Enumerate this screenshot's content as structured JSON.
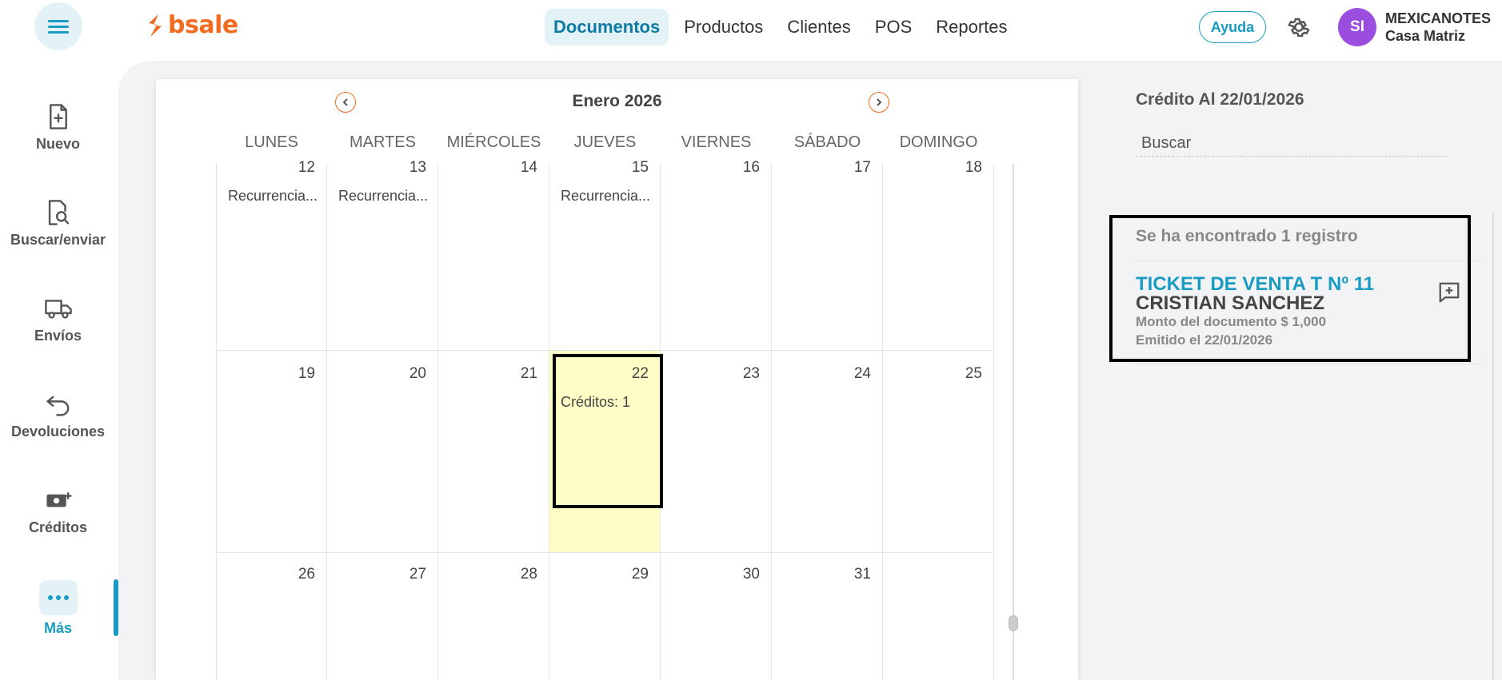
{
  "brand": {
    "logo_text": "bsale",
    "accent": "#f26b21",
    "primary": "#1a9bc4"
  },
  "header": {
    "menu_icon": "hamburger-icon",
    "nav": [
      {
        "label": "Documentos",
        "active": true
      },
      {
        "label": "Productos",
        "active": false
      },
      {
        "label": "Clientes",
        "active": false
      },
      {
        "label": "POS",
        "active": false
      },
      {
        "label": "Reportes",
        "active": false
      }
    ],
    "help_label": "Ayuda",
    "settings_icon": "gear-icon",
    "avatar_initials": "SI",
    "company_name": "MEXICANOTES",
    "branch_name": "Casa Matriz"
  },
  "sidebar": {
    "items": [
      {
        "label": "Nuevo",
        "icon": "new-document-icon"
      },
      {
        "label": "Buscar/enviar",
        "icon": "search-document-icon"
      },
      {
        "label": "Envíos",
        "icon": "truck-icon"
      },
      {
        "label": "Devoluciones",
        "icon": "return-arrow-icon"
      },
      {
        "label": "Créditos",
        "icon": "credit-money-icon"
      },
      {
        "label": "Más",
        "icon": "more-dots-icon",
        "active": true
      }
    ]
  },
  "calendar": {
    "month_label": "Enero 2026",
    "prev_icon": "chevron-left-icon",
    "next_icon": "chevron-right-icon",
    "weekdays": [
      "LUNES",
      "MARTES",
      "MIÉRCOLES",
      "JUEVES",
      "VIERNES",
      "SÁBADO",
      "DOMINGO"
    ],
    "weeks": [
      [
        {
          "day": "12",
          "event": "Recurrencia..."
        },
        {
          "day": "13",
          "event": "Recurrencia..."
        },
        {
          "day": "14",
          "event": ""
        },
        {
          "day": "15",
          "event": "Recurrencia..."
        },
        {
          "day": "16",
          "event": ""
        },
        {
          "day": "17",
          "event": ""
        },
        {
          "day": "18",
          "event": ""
        }
      ],
      [
        {
          "day": "19",
          "event": ""
        },
        {
          "day": "20",
          "event": ""
        },
        {
          "day": "21",
          "event": ""
        },
        {
          "day": "22",
          "event": "Créditos: 1",
          "highlighted": true
        },
        {
          "day": "23",
          "event": ""
        },
        {
          "day": "24",
          "event": ""
        },
        {
          "day": "25",
          "event": ""
        }
      ],
      [
        {
          "day": "26",
          "event": ""
        },
        {
          "day": "27",
          "event": ""
        },
        {
          "day": "28",
          "event": ""
        },
        {
          "day": "29",
          "event": ""
        },
        {
          "day": "30",
          "event": ""
        },
        {
          "day": "31",
          "event": ""
        },
        {
          "day": "",
          "event": ""
        }
      ]
    ]
  },
  "panel": {
    "title": "Crédito Al 22/01/2026",
    "search_placeholder": "Buscar",
    "results_count": "Se ha encontrado 1 registro",
    "result": {
      "title": "TICKET DE VENTA T Nº 11",
      "client": "CRISTIAN SANCHEZ",
      "amount": "Monto del documento $ 1,000",
      "issued": "Emitido el 22/01/2026",
      "action_icon": "add-comment-icon"
    }
  }
}
